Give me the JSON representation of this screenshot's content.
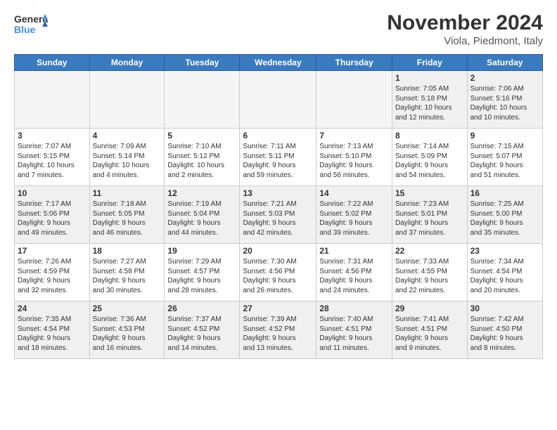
{
  "header": {
    "logo_general": "General",
    "logo_blue": "Blue",
    "month_title": "November 2024",
    "subtitle": "Viola, Piedmont, Italy"
  },
  "days_of_week": [
    "Sunday",
    "Monday",
    "Tuesday",
    "Wednesday",
    "Thursday",
    "Friday",
    "Saturday"
  ],
  "weeks": [
    [
      {
        "day": "",
        "text": ""
      },
      {
        "day": "",
        "text": ""
      },
      {
        "day": "",
        "text": ""
      },
      {
        "day": "",
        "text": ""
      },
      {
        "day": "",
        "text": ""
      },
      {
        "day": "1",
        "text": "Sunrise: 7:05 AM\nSunset: 5:18 PM\nDaylight: 10 hours\nand 12 minutes."
      },
      {
        "day": "2",
        "text": "Sunrise: 7:06 AM\nSunset: 5:16 PM\nDaylight: 10 hours\nand 10 minutes."
      }
    ],
    [
      {
        "day": "3",
        "text": "Sunrise: 7:07 AM\nSunset: 5:15 PM\nDaylight: 10 hours\nand 7 minutes."
      },
      {
        "day": "4",
        "text": "Sunrise: 7:09 AM\nSunset: 5:14 PM\nDaylight: 10 hours\nand 4 minutes."
      },
      {
        "day": "5",
        "text": "Sunrise: 7:10 AM\nSunset: 5:12 PM\nDaylight: 10 hours\nand 2 minutes."
      },
      {
        "day": "6",
        "text": "Sunrise: 7:11 AM\nSunset: 5:11 PM\nDaylight: 9 hours\nand 59 minutes."
      },
      {
        "day": "7",
        "text": "Sunrise: 7:13 AM\nSunset: 5:10 PM\nDaylight: 9 hours\nand 56 minutes."
      },
      {
        "day": "8",
        "text": "Sunrise: 7:14 AM\nSunset: 5:09 PM\nDaylight: 9 hours\nand 54 minutes."
      },
      {
        "day": "9",
        "text": "Sunrise: 7:15 AM\nSunset: 5:07 PM\nDaylight: 9 hours\nand 51 minutes."
      }
    ],
    [
      {
        "day": "10",
        "text": "Sunrise: 7:17 AM\nSunset: 5:06 PM\nDaylight: 9 hours\nand 49 minutes."
      },
      {
        "day": "11",
        "text": "Sunrise: 7:18 AM\nSunset: 5:05 PM\nDaylight: 9 hours\nand 46 minutes."
      },
      {
        "day": "12",
        "text": "Sunrise: 7:19 AM\nSunset: 5:04 PM\nDaylight: 9 hours\nand 44 minutes."
      },
      {
        "day": "13",
        "text": "Sunrise: 7:21 AM\nSunset: 5:03 PM\nDaylight: 9 hours\nand 42 minutes."
      },
      {
        "day": "14",
        "text": "Sunrise: 7:22 AM\nSunset: 5:02 PM\nDaylight: 9 hours\nand 39 minutes."
      },
      {
        "day": "15",
        "text": "Sunrise: 7:23 AM\nSunset: 5:01 PM\nDaylight: 9 hours\nand 37 minutes."
      },
      {
        "day": "16",
        "text": "Sunrise: 7:25 AM\nSunset: 5:00 PM\nDaylight: 9 hours\nand 35 minutes."
      }
    ],
    [
      {
        "day": "17",
        "text": "Sunrise: 7:26 AM\nSunset: 4:59 PM\nDaylight: 9 hours\nand 32 minutes."
      },
      {
        "day": "18",
        "text": "Sunrise: 7:27 AM\nSunset: 4:58 PM\nDaylight: 9 hours\nand 30 minutes."
      },
      {
        "day": "19",
        "text": "Sunrise: 7:29 AM\nSunset: 4:57 PM\nDaylight: 9 hours\nand 28 minutes."
      },
      {
        "day": "20",
        "text": "Sunrise: 7:30 AM\nSunset: 4:56 PM\nDaylight: 9 hours\nand 26 minutes."
      },
      {
        "day": "21",
        "text": "Sunrise: 7:31 AM\nSunset: 4:56 PM\nDaylight: 9 hours\nand 24 minutes."
      },
      {
        "day": "22",
        "text": "Sunrise: 7:33 AM\nSunset: 4:55 PM\nDaylight: 9 hours\nand 22 minutes."
      },
      {
        "day": "23",
        "text": "Sunrise: 7:34 AM\nSunset: 4:54 PM\nDaylight: 9 hours\nand 20 minutes."
      }
    ],
    [
      {
        "day": "24",
        "text": "Sunrise: 7:35 AM\nSunset: 4:54 PM\nDaylight: 9 hours\nand 18 minutes."
      },
      {
        "day": "25",
        "text": "Sunrise: 7:36 AM\nSunset: 4:53 PM\nDaylight: 9 hours\nand 16 minutes."
      },
      {
        "day": "26",
        "text": "Sunrise: 7:37 AM\nSunset: 4:52 PM\nDaylight: 9 hours\nand 14 minutes."
      },
      {
        "day": "27",
        "text": "Sunrise: 7:39 AM\nSunset: 4:52 PM\nDaylight: 9 hours\nand 13 minutes."
      },
      {
        "day": "28",
        "text": "Sunrise: 7:40 AM\nSunset: 4:51 PM\nDaylight: 9 hours\nand 11 minutes."
      },
      {
        "day": "29",
        "text": "Sunrise: 7:41 AM\nSunset: 4:51 PM\nDaylight: 9 hours\nand 9 minutes."
      },
      {
        "day": "30",
        "text": "Sunrise: 7:42 AM\nSunset: 4:50 PM\nDaylight: 9 hours\nand 8 minutes."
      }
    ]
  ]
}
